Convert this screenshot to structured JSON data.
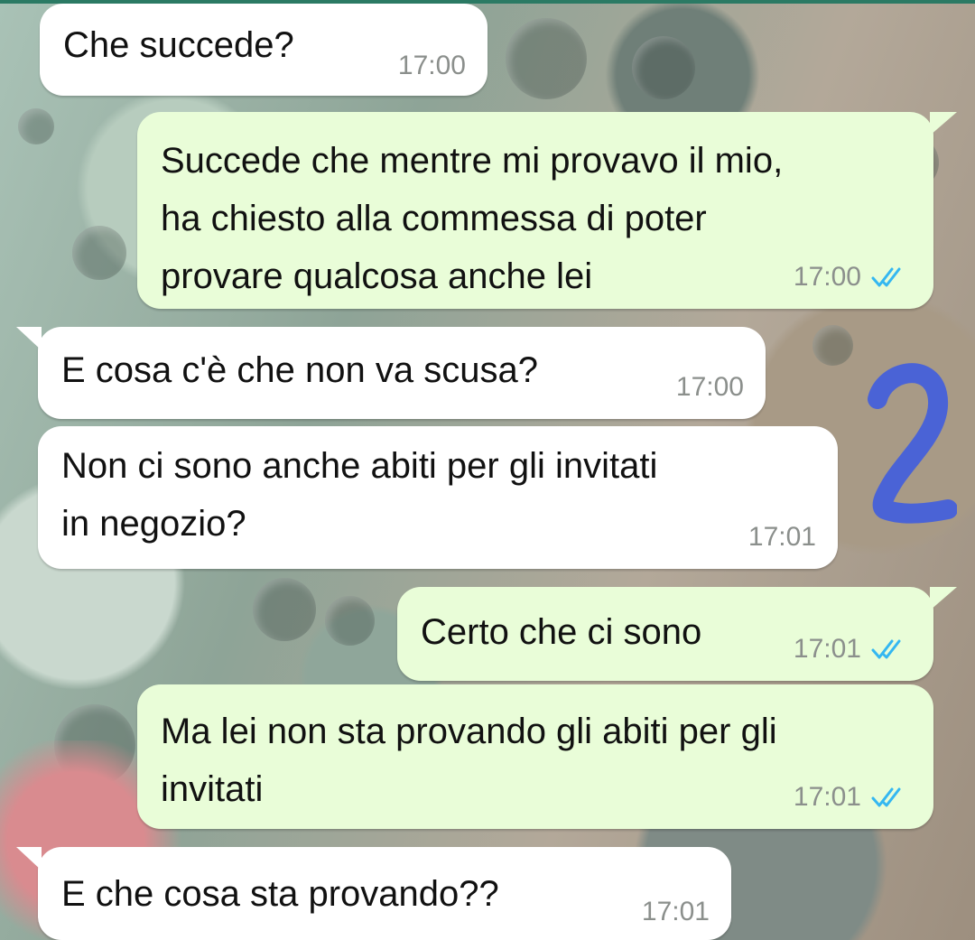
{
  "chat": {
    "messages": [
      {
        "direction": "incoming",
        "text": "Che succede?",
        "time": "17:00"
      },
      {
        "direction": "outgoing",
        "text": "Succede che mentre mi provavo il mio,\nha chiesto alla commessa di poter\nprovare qualcosa anche lei",
        "time": "17:00",
        "status": "read"
      },
      {
        "direction": "incoming",
        "text": "E cosa c'è che non va scusa?",
        "time": "17:00"
      },
      {
        "direction": "incoming",
        "text": "Non ci sono anche abiti per gli invitati\nin negozio?",
        "time": "17:01"
      },
      {
        "direction": "outgoing",
        "text": "Certo che ci sono",
        "time": "17:01",
        "status": "read"
      },
      {
        "direction": "outgoing",
        "text": "Ma lei non sta provando gli abiti per gli\ninvitati",
        "time": "17:01",
        "status": "read"
      },
      {
        "direction": "incoming",
        "text": "E che cosa sta provando??",
        "time": "17:01"
      }
    ]
  },
  "annotation": {
    "mark": "2",
    "color": "#4a63d6"
  },
  "colors": {
    "incoming_bubble": "#ffffff",
    "outgoing_bubble": "#e9fdd8",
    "time_text": "#8b8f8c",
    "read_ticks": "#34b7f1"
  },
  "icons": {
    "read_status": "double-check-icon"
  }
}
